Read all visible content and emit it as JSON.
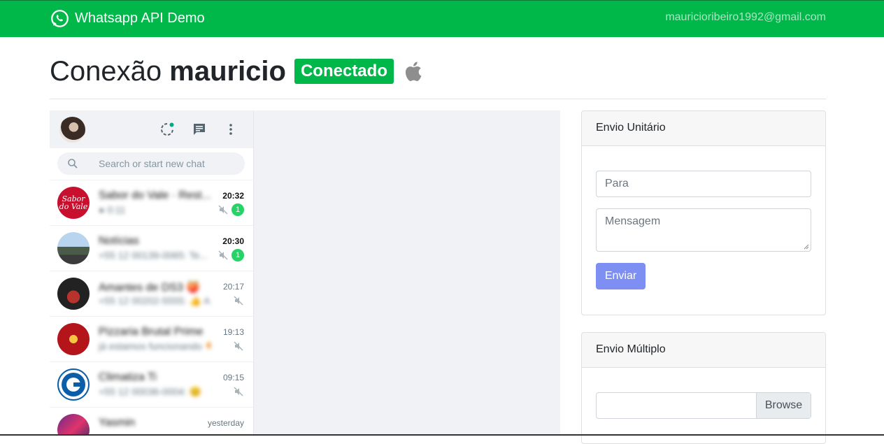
{
  "navbar": {
    "brand": "Whatsapp API Demo",
    "brand_icon": "whatsapp-icon",
    "email": "mauricioribeiro1992@gmail.com",
    "color": "#00b84a"
  },
  "header": {
    "title_prefix": "Conexão",
    "title_name": "mauricio",
    "status_badge": "Conectado",
    "platform_icon": "apple-icon"
  },
  "whatsapp": {
    "search_placeholder": "Search or start new chat",
    "chats": [
      {
        "name": "Sabor do Vale · Rest...",
        "preview": "● 0:11",
        "time": "20:32",
        "unread": "1",
        "bold": true
      },
      {
        "name": "Notícias",
        "preview": "+55 12 00139-0065: Te...",
        "time": "20:30",
        "unread": "1",
        "bold": true
      },
      {
        "name": "Amantes de DS3 🍑",
        "preview": "+55 12 00202-5555: 👍 Ag",
        "time": "20:17",
        "unread": "",
        "bold": false
      },
      {
        "name": "Pizzaria Brutal Prime",
        "preview": "já estamos funcionando 🍕",
        "time": "19:13",
        "unread": "",
        "bold": false
      },
      {
        "name": "Climatiza Ti",
        "preview": "+55 12 00036-0004: 😊",
        "time": "09:15",
        "unread": "",
        "bold": false
      },
      {
        "name": "Yasmin",
        "preview": "",
        "time": "yesterday",
        "unread": "",
        "bold": false
      }
    ]
  },
  "single_send": {
    "title": "Envio Unitário",
    "to_placeholder": "Para",
    "message_placeholder": "Mensagem",
    "send_label": "Enviar"
  },
  "multi_send": {
    "title": "Envio Múltiplo",
    "browse_label": "Browse"
  }
}
